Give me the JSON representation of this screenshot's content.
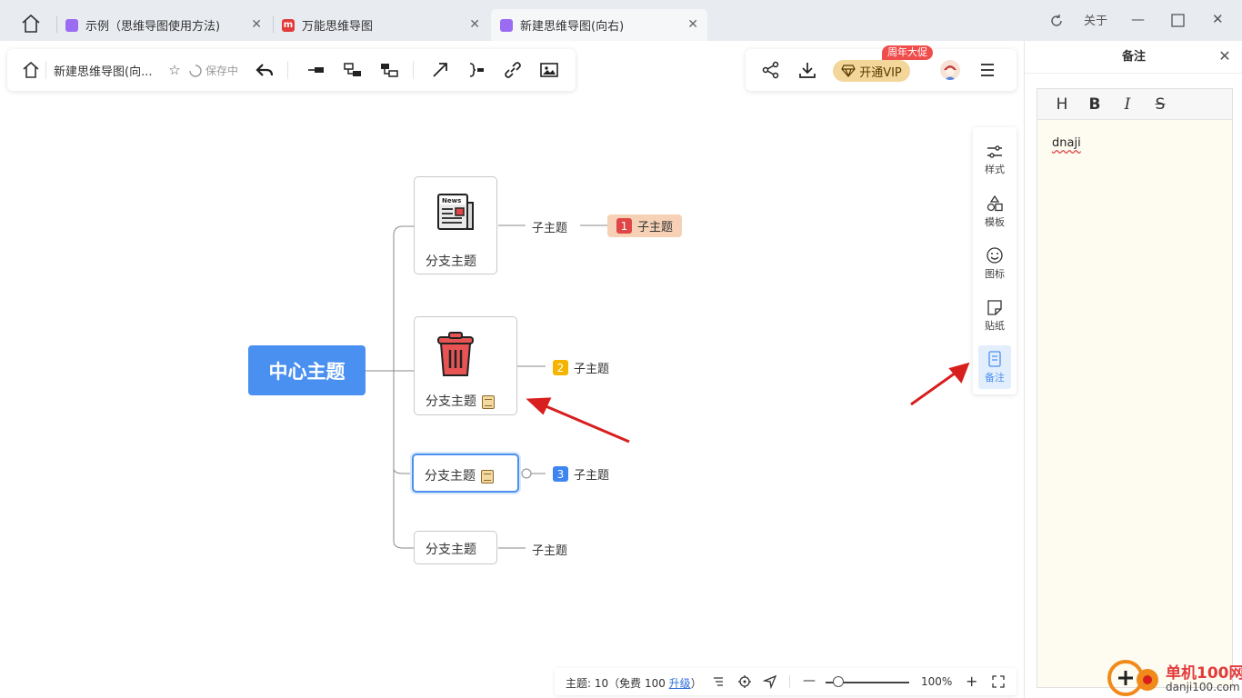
{
  "tabs": [
    {
      "label": "示例（思维导图使用方法)",
      "icon": "mindmap-app-icon"
    },
    {
      "label": "万能思维导图",
      "icon": "brand-m-icon"
    },
    {
      "label": "新建思维导图(向右)",
      "icon": "mindmap-app-icon",
      "active": true
    }
  ],
  "window": {
    "about": "关于"
  },
  "toolbar": {
    "doc_title": "新建思维导图(向...",
    "saving": "保存中",
    "vip_button": "开通VIP",
    "vip_badge": "周年大促"
  },
  "mindmap": {
    "center": "中心主题",
    "branches": [
      {
        "label": "分支主题",
        "icon": "newspaper-icon",
        "subtopic": "子主题",
        "subtopic2": "子主题",
        "subtopic2_number": "1",
        "subtopic2_color": "#e04646"
      },
      {
        "label": "分支主题",
        "icon": "trash-bin-icon",
        "has_note": true,
        "subtopic": "子主题",
        "subtopic_number": "2",
        "subtopic_color": "#f5b400"
      },
      {
        "label": "分支主题",
        "has_note": true,
        "selected": true,
        "subtopic": "子主题",
        "subtopic_number": "3",
        "subtopic_color": "#3d86f2"
      },
      {
        "label": "分支主题",
        "subtopic": "子主题"
      }
    ]
  },
  "rail": [
    {
      "label": "样式",
      "icon": "style-sliders-icon"
    },
    {
      "label": "模板",
      "icon": "template-shapes-icon"
    },
    {
      "label": "图标",
      "icon": "smiley-icon"
    },
    {
      "label": "贴纸",
      "icon": "sticker-icon"
    },
    {
      "label": "备注",
      "icon": "note-icon",
      "active": true
    }
  ],
  "status": {
    "topics_prefix": "主题: 10（免费 100 ",
    "upgrade": "升级",
    "topics_suffix": "）",
    "zoom": "100%",
    "zoom_level": 0.15
  },
  "notes": {
    "title": "备注",
    "toolbar": [
      "H",
      "B",
      "I",
      "S"
    ],
    "content": "dnaji"
  },
  "watermark": {
    "line1": "单机100网",
    "line2": "danji100.com"
  },
  "colors": {
    "accent": "#4a90f0",
    "arrow": "#d81e1e",
    "vip": "#f3d69a"
  }
}
